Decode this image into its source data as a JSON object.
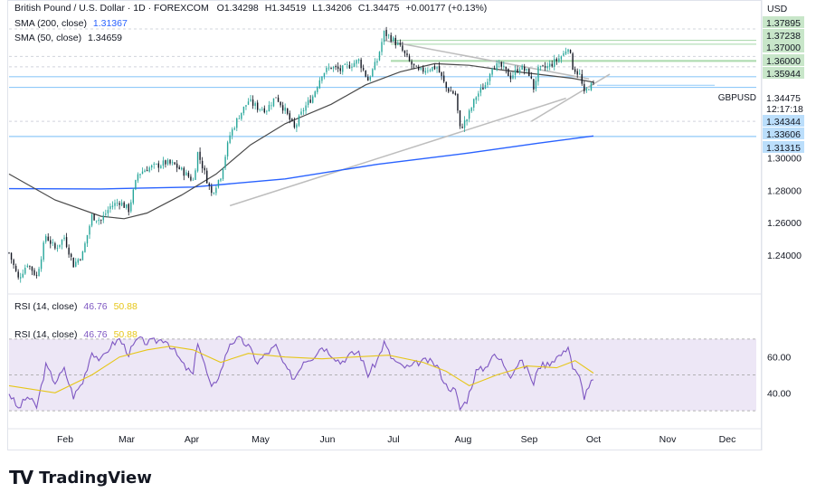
{
  "header": {
    "symbol": "British Pound / U.S. Dollar · 1D · FOREXCOM",
    "open_label": "O",
    "open": "1.34298",
    "high_label": "H",
    "high": "1.34519",
    "low_label": "L",
    "low": "1.34206",
    "close_label": "C",
    "close": "1.34475",
    "change": "+0.00177 (+0.13%)"
  },
  "legends": {
    "sma200_label": "SMA (200, close)",
    "sma200_value": "1.31367",
    "sma50_label": "SMA (50, close)",
    "sma50_value": "1.34659",
    "rsi_label": "RSI (14, close)",
    "rsi_value": "46.76",
    "rsi_ma_value": "50.88",
    "rsi_overlay_label": "RSI (14, close)",
    "rsi_overlay_value": "46.76",
    "rsi_overlay_ma_value": "50.88"
  },
  "branding": {
    "logo_name": "TradingView"
  },
  "colors": {
    "up": "#26a69a",
    "down": "#131722",
    "sma200": "#2962ff",
    "sma50": "#4a4a4a",
    "rsi": "#7e57c2",
    "rsi_ma": "#e6c619",
    "rsi_band": "#ede7f6",
    "hline": "#90caf9",
    "green_line": "#a5d6a7",
    "trendline": "#bdbdbd"
  },
  "chart_data": [
    {
      "type": "candlestick",
      "title": "British Pound / U.S. Dollar",
      "currency_label": "USD",
      "ylim": [
        1.22,
        1.385
      ],
      "price_ticks": [
        "1.30000",
        "1.28000",
        "1.26000",
        "1.24000"
      ],
      "x_ticks": [
        "Feb",
        "Mar",
        "Apr",
        "May",
        "Jun",
        "Jul",
        "Aug",
        "Sep",
        "Oct",
        "Nov",
        "Dec"
      ],
      "price_scale_labels": [
        {
          "text": "1.37895",
          "value": 1.37895,
          "kind": "green"
        },
        {
          "text": "1.37238",
          "value": 1.37238,
          "kind": "green"
        },
        {
          "text": "1.37000",
          "value": 1.37,
          "kind": "green"
        },
        {
          "text": "1.36000",
          "value": 1.36,
          "kind": "green"
        },
        {
          "text": "1.35944",
          "value": 1.35944,
          "kind": "green"
        },
        {
          "text": "1.34475",
          "value": 1.34475,
          "kind": "price"
        },
        {
          "text": "12:17:18",
          "value": 1.3407,
          "kind": "timer"
        },
        {
          "text": "1.34344",
          "value": 1.34344,
          "kind": "blue"
        },
        {
          "text": "1.33606",
          "value": 1.33606,
          "kind": "blue"
        },
        {
          "text": "1.31315",
          "value": 1.31315,
          "kind": "blue"
        }
      ],
      "price_label_symbol": "GBPUSD",
      "horizontal_levels": [
        {
          "value": 1.37238,
          "kind": "green"
        },
        {
          "value": 1.37,
          "kind": "green"
        },
        {
          "value": 1.36,
          "kind": "green"
        },
        {
          "value": 1.35944,
          "kind": "green"
        },
        {
          "value": 1.35,
          "kind": "blue"
        },
        {
          "value": 1.34344,
          "kind": "blue"
        },
        {
          "value": 1.31315,
          "kind": "blue"
        },
        {
          "value": 1.3794,
          "kind": "dashed"
        },
        {
          "value": 1.3625,
          "kind": "dashed"
        },
        {
          "value": 1.3561,
          "kind": "dashed"
        },
        {
          "value": 1.3225,
          "kind": "dashed"
        }
      ],
      "trendlines": [
        {
          "from": [
            96,
            1.2705
          ],
          "to": [
            235,
            1.3335
          ]
        },
        {
          "from": [
            163,
            1.3723
          ],
          "to": [
            245,
            1.3505
          ]
        },
        {
          "from": [
            227,
            1.3225
          ],
          "to": [
            254,
            1.3455
          ]
        }
      ],
      "waypoints": [
        [
          0,
          1.2415
        ],
        [
          4,
          1.2255
        ],
        [
          8,
          1.235
        ],
        [
          12,
          1.227
        ],
        [
          16,
          1.252
        ],
        [
          20,
          1.244
        ],
        [
          24,
          1.251
        ],
        [
          28,
          1.234
        ],
        [
          32,
          1.241
        ],
        [
          36,
          1.264
        ],
        [
          40,
          1.2615
        ],
        [
          44,
          1.27
        ],
        [
          48,
          1.273
        ],
        [
          52,
          1.268
        ],
        [
          56,
          1.29
        ],
        [
          60,
          1.2935
        ],
        [
          64,
          1.295
        ],
        [
          68,
          1.297
        ],
        [
          72,
          1.2955
        ],
        [
          76,
          1.291
        ],
        [
          80,
          1.286
        ],
        [
          82,
          1.303
        ],
        [
          84,
          1.295
        ],
        [
          88,
          1.278
        ],
        [
          92,
          1.289
        ],
        [
          96,
          1.314
        ],
        [
          100,
          1.326
        ],
        [
          104,
          1.335
        ],
        [
          108,
          1.331
        ],
        [
          112,
          1.33
        ],
        [
          116,
          1.338
        ],
        [
          120,
          1.329
        ],
        [
          124,
          1.318
        ],
        [
          128,
          1.33
        ],
        [
          132,
          1.338
        ],
        [
          136,
          1.352
        ],
        [
          140,
          1.356
        ],
        [
          144,
          1.354
        ],
        [
          148,
          1.357
        ],
        [
          152,
          1.36
        ],
        [
          156,
          1.348
        ],
        [
          160,
          1.36
        ],
        [
          163,
          1.377
        ],
        [
          166,
          1.374
        ],
        [
          170,
          1.368
        ],
        [
          174,
          1.359
        ],
        [
          178,
          1.353
        ],
        [
          182,
          1.355
        ],
        [
          186,
          1.356
        ],
        [
          190,
          1.343
        ],
        [
          194,
          1.339
        ],
        [
          196,
          1.318
        ],
        [
          199,
          1.324
        ],
        [
          203,
          1.338
        ],
        [
          207,
          1.345
        ],
        [
          210,
          1.357
        ],
        [
          214,
          1.356
        ],
        [
          218,
          1.35
        ],
        [
          222,
          1.356
        ],
        [
          226,
          1.352
        ],
        [
          228,
          1.343
        ],
        [
          230,
          1.354
        ],
        [
          234,
          1.356
        ],
        [
          238,
          1.36
        ],
        [
          241,
          1.364
        ],
        [
          243,
          1.369
        ],
        [
          245,
          1.356
        ],
        [
          248,
          1.351
        ],
        [
          250,
          1.339
        ],
        [
          252,
          1.344
        ],
        [
          254,
          1.345
        ]
      ],
      "sma200_series": [
        [
          0,
          1.281
        ],
        [
          40,
          1.2808
        ],
        [
          80,
          1.282
        ],
        [
          120,
          1.287
        ],
        [
          160,
          1.296
        ],
        [
          200,
          1.303
        ],
        [
          230,
          1.309
        ],
        [
          254,
          1.3135
        ]
      ],
      "sma50_series": [
        [
          0,
          1.29
        ],
        [
          20,
          1.274
        ],
        [
          40,
          1.264
        ],
        [
          50,
          1.2625
        ],
        [
          60,
          1.266
        ],
        [
          75,
          1.277
        ],
        [
          90,
          1.29
        ],
        [
          105,
          1.308
        ],
        [
          120,
          1.321
        ],
        [
          140,
          1.333
        ],
        [
          155,
          1.345
        ],
        [
          170,
          1.353
        ],
        [
          185,
          1.358
        ],
        [
          200,
          1.357
        ],
        [
          215,
          1.354
        ],
        [
          230,
          1.3515
        ],
        [
          245,
          1.349
        ],
        [
          254,
          1.3466
        ]
      ]
    },
    {
      "type": "line",
      "title": "RSI (14, close)",
      "ylim": [
        25,
        75
      ],
      "y_ticks": [
        "60.00",
        "40.00"
      ],
      "band": [
        30,
        70
      ],
      "midline": 50,
      "rsi_series": [
        [
          0,
          40
        ],
        [
          4,
          31
        ],
        [
          8,
          38
        ],
        [
          12,
          32
        ],
        [
          16,
          55
        ],
        [
          20,
          46
        ],
        [
          24,
          53
        ],
        [
          28,
          38
        ],
        [
          32,
          46
        ],
        [
          36,
          63
        ],
        [
          40,
          58
        ],
        [
          44,
          66
        ],
        [
          48,
          70
        ],
        [
          52,
          62
        ],
        [
          56,
          70
        ],
        [
          60,
          68
        ],
        [
          64,
          69
        ],
        [
          68,
          70
        ],
        [
          72,
          63
        ],
        [
          76,
          55
        ],
        [
          80,
          50
        ],
        [
          82,
          69
        ],
        [
          84,
          60
        ],
        [
          88,
          42
        ],
        [
          92,
          52
        ],
        [
          96,
          68
        ],
        [
          100,
          70
        ],
        [
          104,
          66
        ],
        [
          108,
          57
        ],
        [
          112,
          62
        ],
        [
          116,
          66
        ],
        [
          120,
          54
        ],
        [
          124,
          48
        ],
        [
          128,
          58
        ],
        [
          132,
          60
        ],
        [
          136,
          66
        ],
        [
          140,
          62
        ],
        [
          144,
          57
        ],
        [
          148,
          61
        ],
        [
          152,
          63
        ],
        [
          156,
          50
        ],
        [
          160,
          58
        ],
        [
          163,
          68
        ],
        [
          166,
          60
        ],
        [
          170,
          55
        ],
        [
          174,
          54
        ],
        [
          178,
          57
        ],
        [
          182,
          58
        ],
        [
          186,
          55
        ],
        [
          190,
          44
        ],
        [
          194,
          41
        ],
        [
          196,
          31
        ],
        [
          199,
          36
        ],
        [
          203,
          52
        ],
        [
          207,
          54
        ],
        [
          210,
          61
        ],
        [
          214,
          58
        ],
        [
          218,
          50
        ],
        [
          222,
          58
        ],
        [
          226,
          52
        ],
        [
          228,
          44
        ],
        [
          230,
          55
        ],
        [
          234,
          56
        ],
        [
          238,
          60
        ],
        [
          241,
          62
        ],
        [
          243,
          67
        ],
        [
          245,
          54
        ],
        [
          248,
          48
        ],
        [
          250,
          38
        ],
        [
          252,
          44
        ],
        [
          254,
          47
        ]
      ],
      "rsi_ma_series": [
        [
          0,
          44
        ],
        [
          20,
          40
        ],
        [
          36,
          50
        ],
        [
          48,
          60
        ],
        [
          60,
          64
        ],
        [
          70,
          66
        ],
        [
          80,
          64
        ],
        [
          92,
          57
        ],
        [
          104,
          62
        ],
        [
          120,
          60
        ],
        [
          136,
          59
        ],
        [
          150,
          60
        ],
        [
          165,
          61
        ],
        [
          180,
          57
        ],
        [
          190,
          52
        ],
        [
          200,
          44
        ],
        [
          212,
          50
        ],
        [
          225,
          55
        ],
        [
          238,
          54
        ],
        [
          246,
          58
        ],
        [
          254,
          51
        ]
      ]
    }
  ]
}
